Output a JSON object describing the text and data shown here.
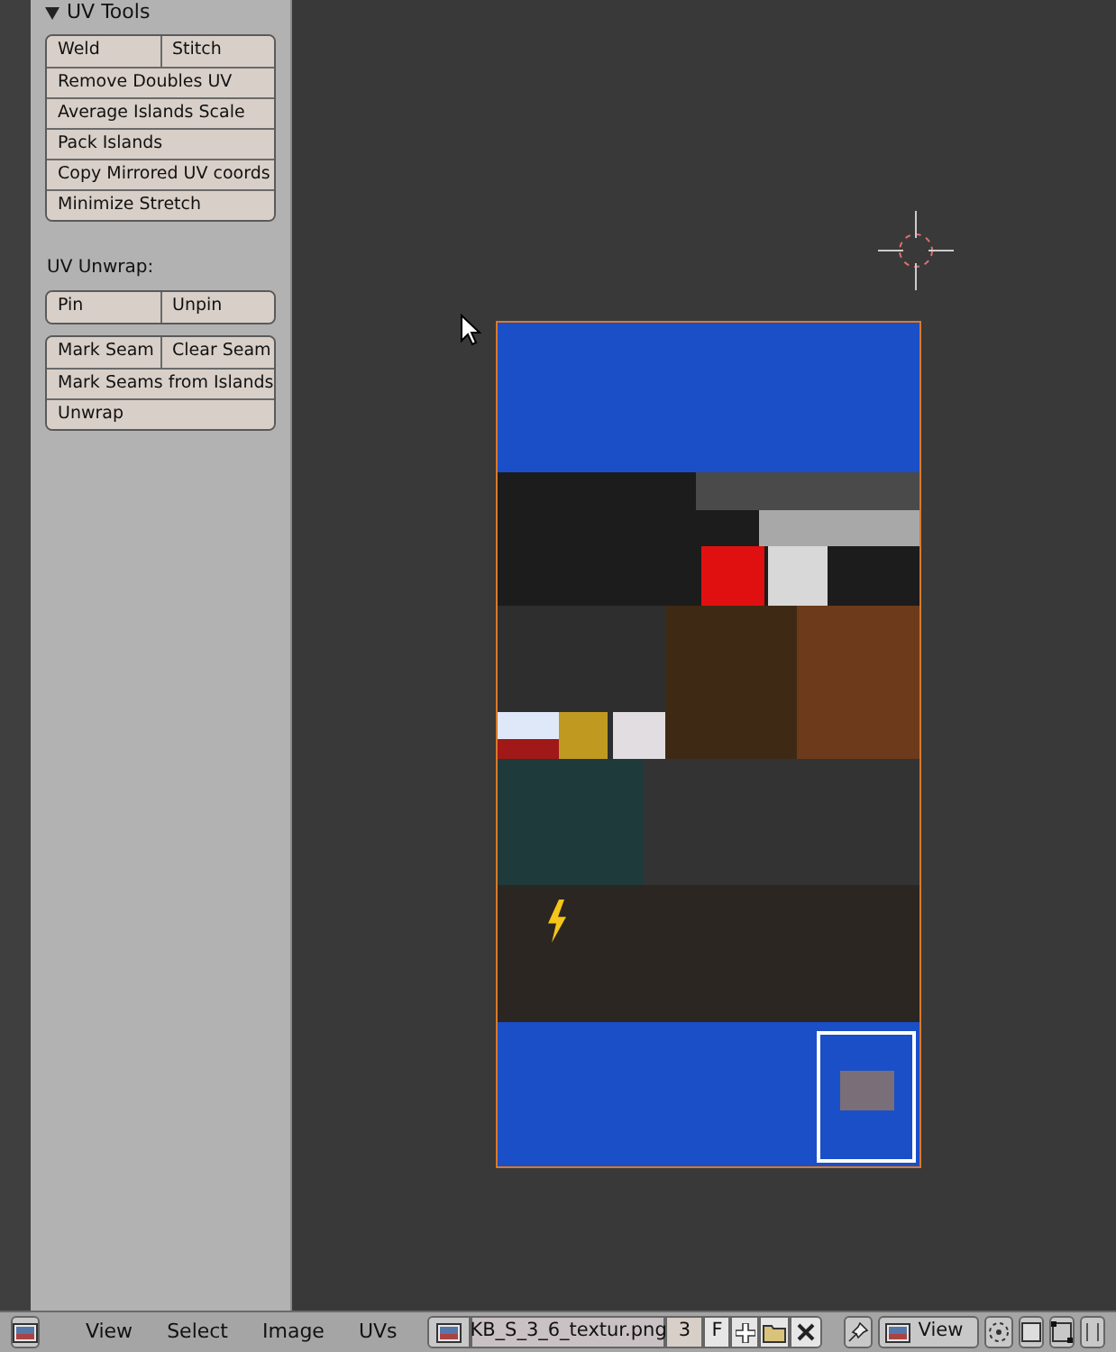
{
  "panel": {
    "title": "UV Tools",
    "expanded": true,
    "groups": [
      {
        "kind": "buttons",
        "rows": [
          [
            "Weld",
            "Stitch"
          ],
          [
            "Remove Doubles UV"
          ],
          [
            "Average Islands Scale"
          ],
          [
            "Pack Islands"
          ],
          [
            "Copy Mirrored UV coords"
          ],
          [
            "Minimize Stretch"
          ]
        ]
      },
      {
        "kind": "label",
        "text": "UV Unwrap:"
      },
      {
        "kind": "buttons",
        "rows": [
          [
            "Pin",
            "Unpin"
          ]
        ]
      },
      {
        "kind": "buttons",
        "rows": [
          [
            "Mark Seam",
            "Clear Seam"
          ],
          [
            "Mark Seams from Islands"
          ],
          [
            "Unwrap"
          ]
        ]
      }
    ]
  },
  "header": {
    "menus": [
      "View",
      "Select",
      "Image",
      "UVs"
    ],
    "image_name": "KB_S_3_6_textur.png",
    "users": "3",
    "fake_user": "F",
    "view_mode": "View"
  }
}
